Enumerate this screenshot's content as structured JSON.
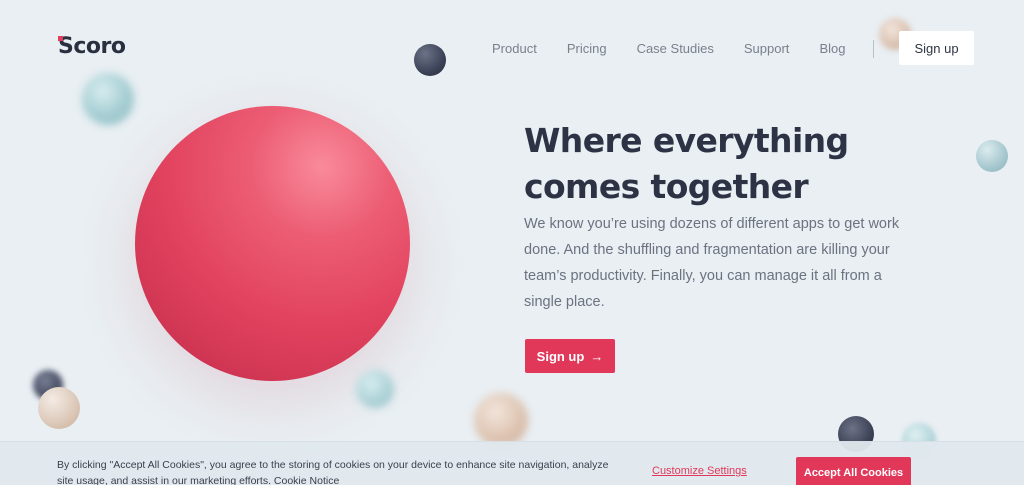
{
  "brand": {
    "logo_text": "Scoro",
    "accent_color": "#e1385a"
  },
  "nav": {
    "items": [
      {
        "label": "Product"
      },
      {
        "label": "Pricing"
      },
      {
        "label": "Case Studies"
      },
      {
        "label": "Support"
      },
      {
        "label": "Blog"
      }
    ],
    "signup_label": "Sign up"
  },
  "hero": {
    "title": "Where everything comes together",
    "description": "We know you’re using dozens of different apps to get work done. And the shuffling and fragmentation are killing your team’s productivity. Finally, you can manage it all from a single place.",
    "cta_label": "Sign up",
    "cta_arrow": "→"
  },
  "cookie_banner": {
    "text": "By clicking \"Accept All Cookies\", you agree to the storing of cookies on your device to enhance site navigation, analyze site usage, and assist in our marketing efforts.",
    "notice_link": "Cookie Notice",
    "customize_label": "Customize Settings",
    "accept_label": "Accept All Cookies"
  }
}
